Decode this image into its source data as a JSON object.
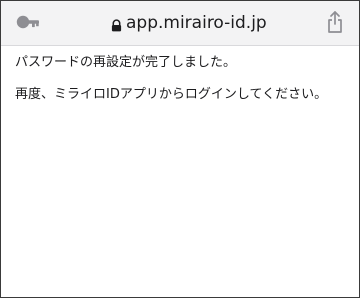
{
  "browser": {
    "url": "app.mirairo-id.jp",
    "icons": {
      "left": "key-icon",
      "lock": "lock-icon",
      "right": "share-icon"
    }
  },
  "page": {
    "message_1": "パスワードの再設定が完了しました。",
    "message_2": "再度、ミライロIDアプリからログインしてください。"
  },
  "colors": {
    "toolbar_bg": "#f3f3f4",
    "icon_gray": "#8e8e93",
    "text": "#1c1c1e",
    "frame_border": "#3a3a3a"
  }
}
